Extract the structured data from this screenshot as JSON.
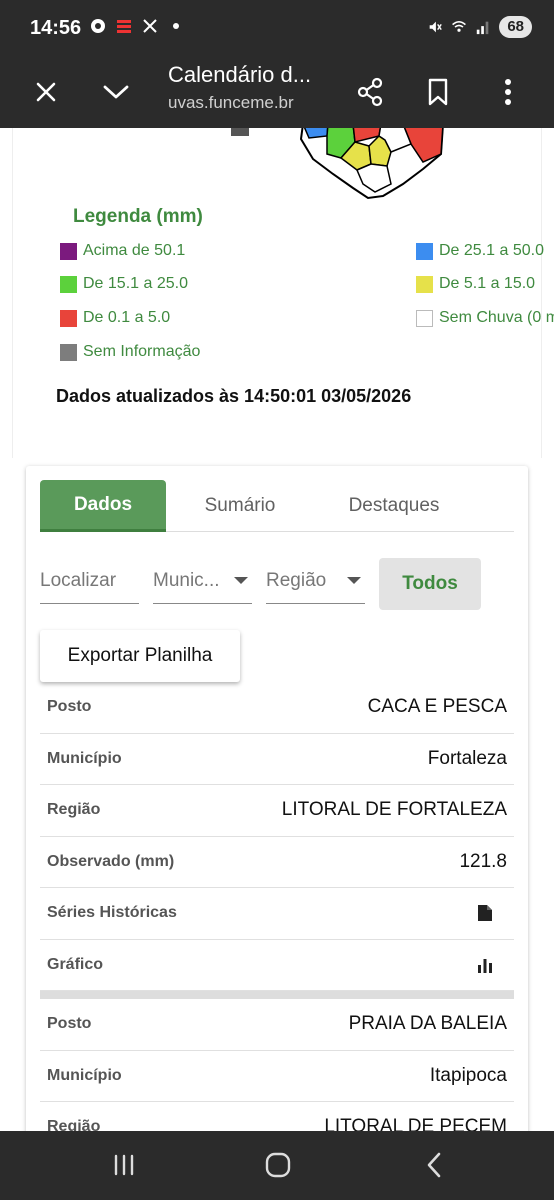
{
  "status_bar": {
    "time": "14:56",
    "battery": "68",
    "left_icons": [
      "chrome-icon",
      "app-icon",
      "x-icon",
      "dot-icon"
    ],
    "right_icons": [
      "mute-icon",
      "wifi-icon",
      "signal-icon"
    ]
  },
  "app_bar": {
    "title": "Calendário d...",
    "url": "uvas.funceme.br",
    "buttons": [
      "close-icon",
      "chevron-down-icon",
      "share-icon",
      "bookmark-icon",
      "more-icon"
    ]
  },
  "legend": {
    "title": "Legenda (mm)",
    "items": [
      {
        "label": "Acima de 50.1",
        "color": "#7b1a7e"
      },
      {
        "label": "De 25.1 a 50.0",
        "color": "#3c8df0"
      },
      {
        "label": "De 15.1 a 25.0",
        "color": "#5cd13c"
      },
      {
        "label": "De 5.1 a 15.0",
        "color": "#e6e14a"
      },
      {
        "label": "De 0.1 a 5.0",
        "color": "#e8443a"
      },
      {
        "label": "Sem Chuva (0 m",
        "color": "#ffffff"
      },
      {
        "label": "Sem Informação",
        "color": "#7d7d7d"
      }
    ]
  },
  "updated_text": "Dados atualizados às 14:50:01 03/05/2026",
  "tabs": [
    {
      "label": "Dados",
      "active": true
    },
    {
      "label": "Sumário",
      "active": false
    },
    {
      "label": "Destaques",
      "active": false
    }
  ],
  "filters": {
    "search_placeholder": "Localizar",
    "municipio": "Munic...",
    "regiao": "Região",
    "todos_label": "Todos"
  },
  "export_label": "Exportar Planilha",
  "records": [
    {
      "rows": [
        {
          "label": "Posto",
          "value": "CACA E PESCA"
        },
        {
          "label": "Município",
          "value": "Fortaleza"
        },
        {
          "label": "Região",
          "value": "LITORAL DE FORTALEZA"
        },
        {
          "label": "Observado (mm)",
          "value": "121.8"
        },
        {
          "label": "Séries Históricas",
          "icon": "document-icon"
        },
        {
          "label": "Gráfico",
          "icon": "bar-chart-icon"
        }
      ]
    },
    {
      "rows": [
        {
          "label": "Posto",
          "value": "PRAIA DA BALEIA"
        },
        {
          "label": "Município",
          "value": "Itapipoca"
        },
        {
          "label": "Região",
          "value": "LITORAL DE PECEM"
        }
      ]
    }
  ],
  "nav_bar": [
    "recents-icon",
    "home-icon",
    "back-icon"
  ]
}
